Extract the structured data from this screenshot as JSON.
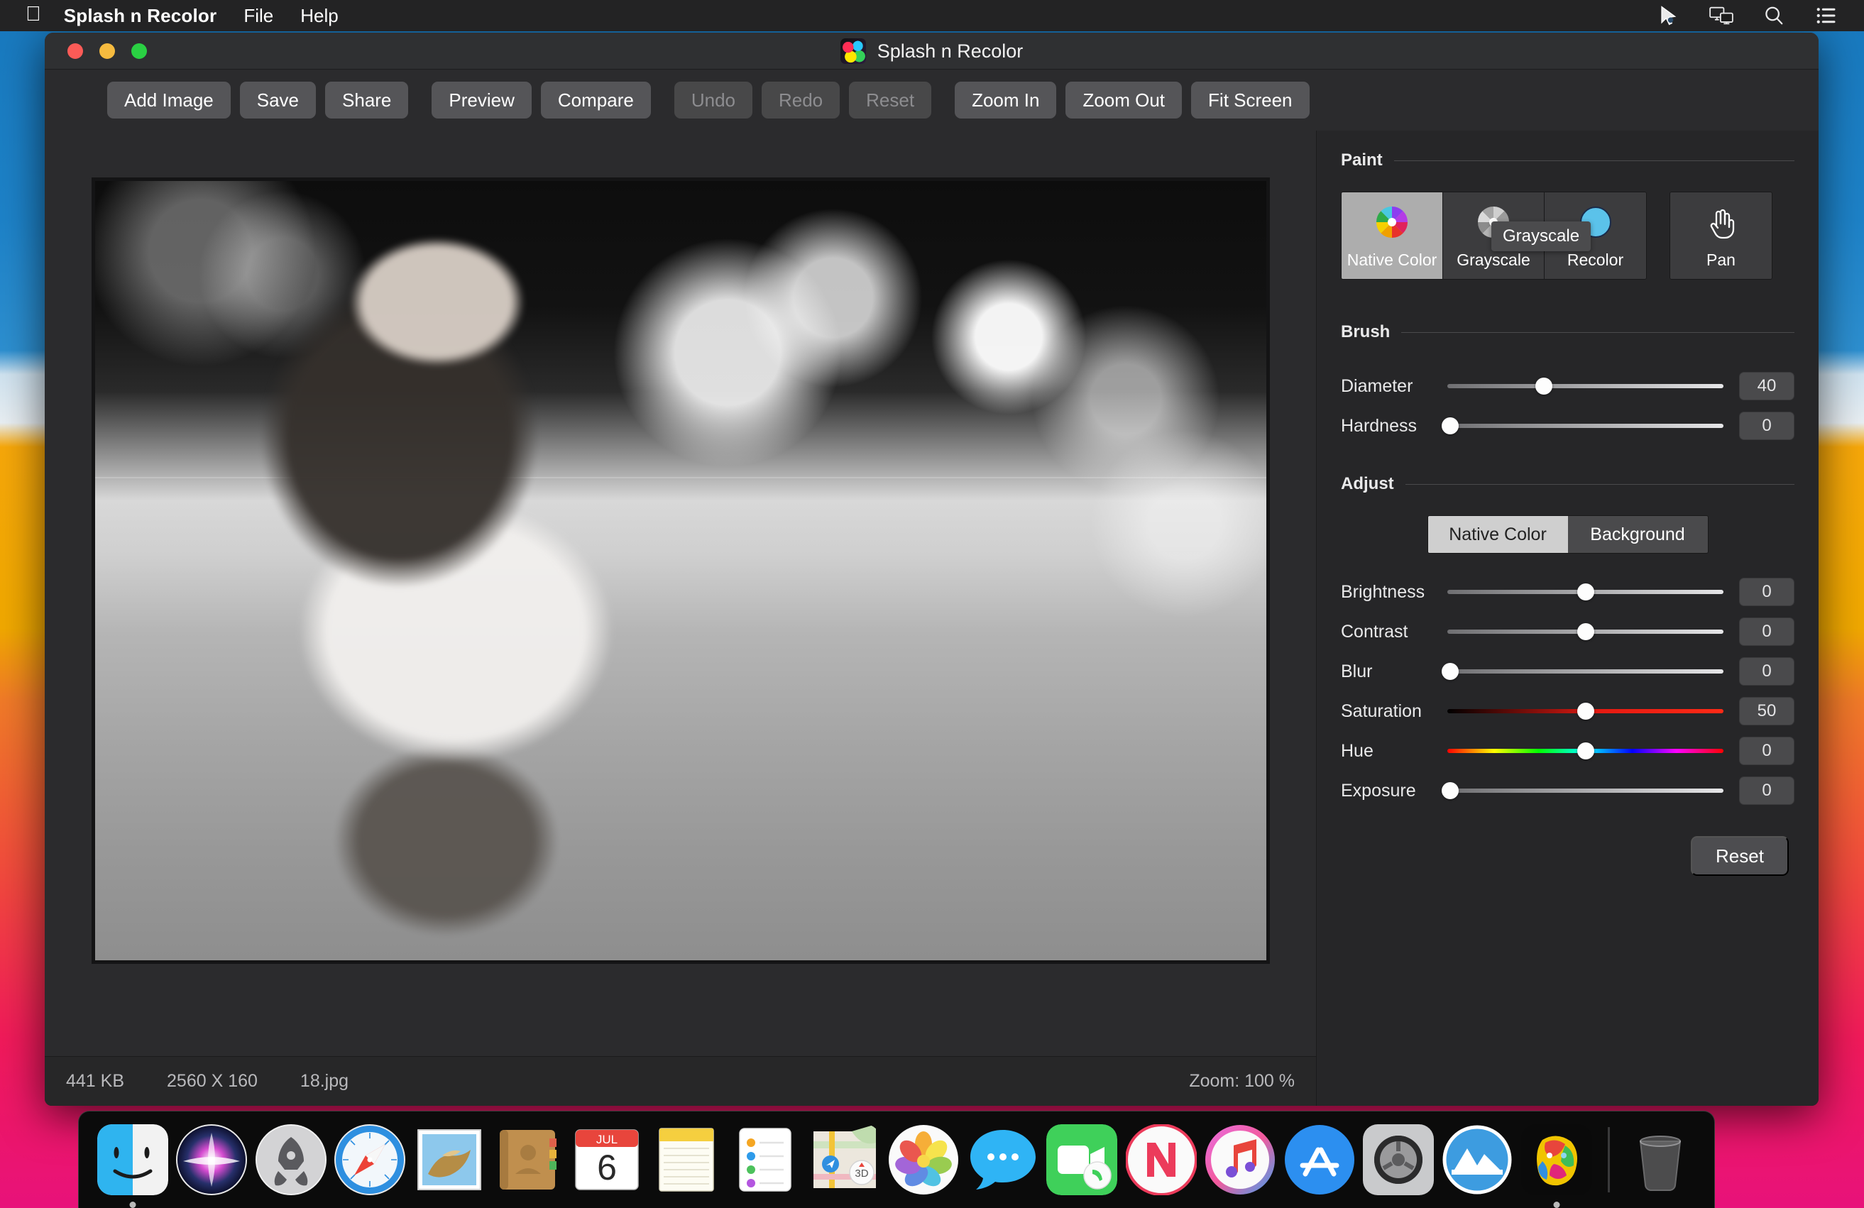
{
  "menubar": {
    "apple_glyph": "",
    "app_title": "Splash n Recolor",
    "items": [
      {
        "label": "File"
      },
      {
        "label": "Help"
      }
    ],
    "right_icons": [
      {
        "name": "cursor-pointer-icon"
      },
      {
        "name": "screen-mirroring-icon"
      },
      {
        "name": "spotlight-search-icon"
      },
      {
        "name": "control-center-icon"
      }
    ]
  },
  "window": {
    "title": "Splash n Recolor",
    "traffic_lights": [
      "close",
      "minimize",
      "zoom"
    ]
  },
  "toolbar": {
    "groups": [
      [
        {
          "label": "Add Image",
          "disabled": false
        },
        {
          "label": "Save",
          "disabled": false
        },
        {
          "label": "Share",
          "disabled": false
        }
      ],
      [
        {
          "label": "Preview",
          "disabled": false
        },
        {
          "label": "Compare",
          "disabled": false
        }
      ],
      [
        {
          "label": "Undo",
          "disabled": true
        },
        {
          "label": "Redo",
          "disabled": true
        },
        {
          "label": "Reset",
          "disabled": true
        }
      ],
      [
        {
          "label": "Zoom In",
          "disabled": false
        },
        {
          "label": "Zoom Out",
          "disabled": false
        },
        {
          "label": "Fit Screen",
          "disabled": false
        }
      ]
    ]
  },
  "statusbar": {
    "file_size": "441 KB",
    "dimensions": "2560 X 160",
    "filename": "18.jpg",
    "zoom": "Zoom: 100 %"
  },
  "inspector": {
    "paint": {
      "title": "Paint",
      "tiles": [
        {
          "label": "Native Color",
          "icon": "color-wheel-icon",
          "active": true
        },
        {
          "label": "Grayscale",
          "icon": "gray-wheel-icon",
          "active": false
        },
        {
          "label": "Recolor",
          "icon": "blue-circle-icon",
          "active": false
        }
      ],
      "pan": {
        "label": "Pan",
        "icon": "hand-pan-icon"
      },
      "tooltip": "Grayscale"
    },
    "brush": {
      "title": "Brush",
      "sliders": [
        {
          "label": "Diameter",
          "value": "40",
          "pct": 35,
          "track": "plain"
        },
        {
          "label": "Hardness",
          "value": "0",
          "pct": 1,
          "track": "plain"
        }
      ]
    },
    "adjust": {
      "title": "Adjust",
      "segments": [
        {
          "label": "Native Color",
          "on": true
        },
        {
          "label": "Background",
          "on": false
        }
      ],
      "sliders": [
        {
          "label": "Brightness",
          "value": "0",
          "pct": 50,
          "track": "plain"
        },
        {
          "label": "Contrast",
          "value": "0",
          "pct": 50,
          "track": "plain"
        },
        {
          "label": "Blur",
          "value": "0",
          "pct": 1,
          "track": "plain"
        },
        {
          "label": "Saturation",
          "value": "50",
          "pct": 50,
          "track": "sat"
        },
        {
          "label": "Hue",
          "value": "0",
          "pct": 50,
          "track": "hue"
        },
        {
          "label": "Exposure",
          "value": "0",
          "pct": 1,
          "track": "plain"
        }
      ],
      "reset_label": "Reset"
    }
  },
  "dock": {
    "items": [
      {
        "name": "finder",
        "running": true
      },
      {
        "name": "siri",
        "running": false
      },
      {
        "name": "launchpad",
        "running": false
      },
      {
        "name": "safari",
        "running": true
      },
      {
        "name": "mail",
        "running": false
      },
      {
        "name": "contacts",
        "running": false
      },
      {
        "name": "calendar",
        "running": false,
        "month": "JUL",
        "day": "6"
      },
      {
        "name": "notes",
        "running": false
      },
      {
        "name": "reminders",
        "running": false
      },
      {
        "name": "maps",
        "running": false
      },
      {
        "name": "photos",
        "running": false
      },
      {
        "name": "messages",
        "running": false
      },
      {
        "name": "facetime",
        "running": false
      },
      {
        "name": "news",
        "running": false
      },
      {
        "name": "itunes",
        "running": false
      },
      {
        "name": "app-store",
        "running": false
      },
      {
        "name": "system-preferences",
        "running": false
      },
      {
        "name": "cleanmymac",
        "running": false
      },
      {
        "name": "splash-n-recolor",
        "running": true
      }
    ],
    "trash": {
      "name": "trash"
    }
  },
  "colors": {
    "window_bg": "#2b2b2d",
    "inspector_bg": "#262628",
    "button_bg": "#555558",
    "accent_selected": "#adadad"
  }
}
